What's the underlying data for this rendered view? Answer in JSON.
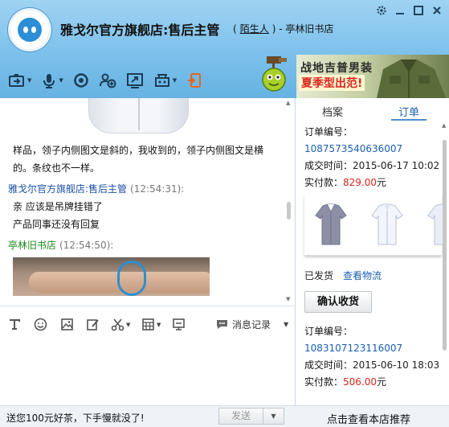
{
  "header": {
    "title": "雅戈尔官方旗舰店:售后主管",
    "stranger_label": "陌生人",
    "separator": "-",
    "account_name": "亭林旧书店"
  },
  "window_controls": [
    "settings-icon",
    "minimize-icon",
    "maximize-icon",
    "close-icon"
  ],
  "toolbar": {
    "icons": [
      "file-transfer-icon",
      "microphone-icon",
      "video-icon",
      "add-contact-icon",
      "screenshot-share-icon",
      "remote-assist-icon",
      "mobile-icon"
    ]
  },
  "ad": {
    "line1": "战地吉普男装",
    "line2": "夏季型出范!"
  },
  "chat": {
    "messages": [
      {
        "type": "text",
        "text": "样品，领子内侧图文是斜的，我收到的，领子内侧图文是横的。条纹也不一样。"
      },
      {
        "type": "sender",
        "name": "雅戈尔官方旗舰店:售后主管",
        "time": "(12:54:31):"
      },
      {
        "type": "text",
        "text": "亲 应该是吊牌挂错了"
      },
      {
        "type": "text",
        "text": "产品同事还没有回复"
      },
      {
        "type": "sender",
        "name": "亭林旧书店",
        "time": "(12:54:50):"
      }
    ]
  },
  "input_toolbar": {
    "icons": [
      "font-icon",
      "emoji-icon",
      "image-icon",
      "edit-icon",
      "scissors-icon",
      "calculator-icon",
      "screen-icon"
    ],
    "history_label": "消息记录"
  },
  "bottom": {
    "ticker": "送您100元好茶，下手慢就没了!",
    "send_label": "发送",
    "recommend_label": "点击查看本店推荐"
  },
  "right_panel": {
    "tabs": [
      "档案",
      "订单"
    ],
    "active_tab": "订单",
    "orders": [
      {
        "number_label": "订单编号：",
        "number": "1087573540636007",
        "date_label": "成交时间：",
        "date": "2015-06-17 10:02",
        "paid_label": "实付款：",
        "amount": "829.00",
        "unit": "元"
      },
      {
        "number_label": "订单编号：",
        "number": "1083107123116007",
        "date_label": "成交时间：",
        "date": "2015-06-10 18:03",
        "paid_label": "实付款：",
        "amount": "506.00",
        "unit": "元"
      }
    ],
    "shipped_label": "已发货",
    "logistics_link": "查看物流",
    "confirm_button": "确认收货"
  },
  "colors": {
    "header_blue": "#79bfea",
    "link_blue": "#1b5fb0",
    "seller_name": "#1b51a8",
    "buyer_name": "#1c8a1c",
    "price_red": "#d8261f"
  }
}
